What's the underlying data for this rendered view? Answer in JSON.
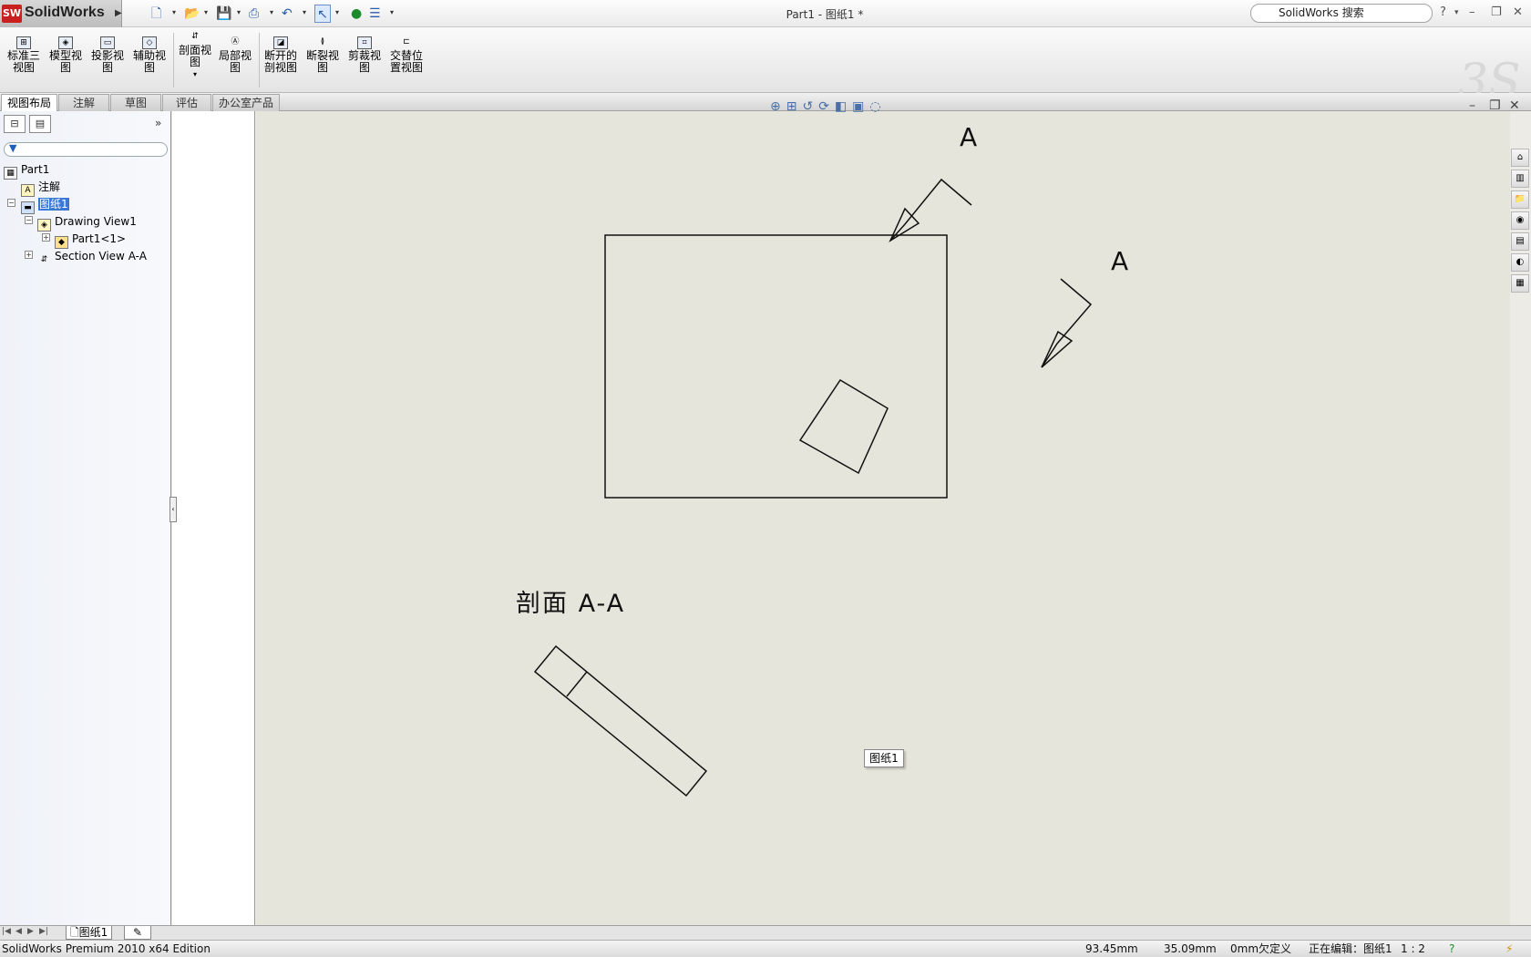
{
  "app": {
    "name": "SolidWorks",
    "logo_mark": "SW"
  },
  "window": {
    "title": "Part1 - 图纸1 *"
  },
  "search": {
    "placeholder": "SolidWorks 搜索"
  },
  "ribbon": {
    "buttons": [
      {
        "label": "标准三视图",
        "icon": "standard-3-view-icon"
      },
      {
        "label": "模型视图",
        "icon": "model-view-icon"
      },
      {
        "label": "投影视图",
        "icon": "projected-view-icon"
      },
      {
        "label": "辅助视图",
        "icon": "auxiliary-view-icon"
      },
      {
        "label": "剖面视图",
        "icon": "section-view-icon"
      },
      {
        "label": "局部视图",
        "icon": "detail-view-icon"
      },
      {
        "label": "断开的剖视图",
        "icon": "broken-out-section-icon"
      },
      {
        "label": "断裂视图",
        "icon": "break-view-icon"
      },
      {
        "label": "剪裁视图",
        "icon": "crop-view-icon"
      },
      {
        "label": "交替位置视图",
        "icon": "alternate-position-view-icon"
      }
    ]
  },
  "tabs": [
    "视图布局",
    "注解",
    "草图",
    "评估",
    "办公室产品"
  ],
  "feature_tree": {
    "root": "Part1",
    "annotations": "注解",
    "sheet": "图纸1",
    "drawing_view": "Drawing View1",
    "part": "Part1<1>",
    "section_view": "Section View A-A"
  },
  "drawing": {
    "section_letter_top": "A",
    "section_letter_right": "A",
    "section_title": "剖面 A-A",
    "sheet_tooltip": "图纸1"
  },
  "sheet_tab": "图纸1",
  "status": {
    "edition": "SolidWorks Premium 2010 x64 Edition",
    "x": "93.45mm",
    "y": "35.09mm",
    "z": "0mm",
    "definition": "欠定义",
    "editing": "正在编辑：图纸1",
    "scale": "1 : 2"
  }
}
